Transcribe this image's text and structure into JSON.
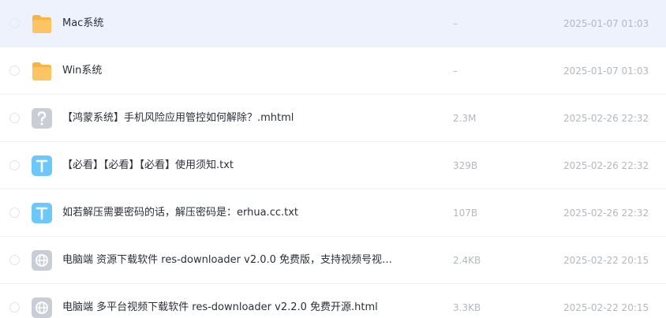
{
  "files": [
    {
      "name": "Mac系统",
      "size": "–",
      "date": "2025-01-07 01:03",
      "icon": "folder-icon",
      "selected": true
    },
    {
      "name": "Win系统",
      "size": "–",
      "date": "2025-01-07 01:03",
      "icon": "folder-icon"
    },
    {
      "name": "【鸿蒙系统】手机风险应用管控如何解除？.mhtml",
      "size": "2.3M",
      "date": "2025-02-26 22:32",
      "icon": "unknown-file-icon"
    },
    {
      "name": "【必看】【必看】【必看】使用须知.txt",
      "size": "329B",
      "date": "2025-02-26 22:32",
      "icon": "text-file-icon"
    },
    {
      "name": "如若解压需要密码的话，解压密码是：erhua.cc.txt",
      "size": "107B",
      "date": "2025-02-26 22:32",
      "icon": "text-file-icon"
    },
    {
      "name": "电脑端 资源下载软件 res-downloader v2.0.0 免费版，支持视频号视…",
      "size": "2.4KB",
      "date": "2025-02-22 20:15",
      "icon": "web-file-icon"
    },
    {
      "name": "电脑端 多平台视频下载软件 res-downloader v2.2.0 免费开源.html",
      "size": "3.3KB",
      "date": "2025-02-22 20:15",
      "icon": "web-file-icon"
    }
  ],
  "colors": {
    "selected_row": "#eef2fd",
    "folder": "#fcc463",
    "text_icon": "#6cc8fb",
    "unknown_icon": "#c9cdd6"
  }
}
